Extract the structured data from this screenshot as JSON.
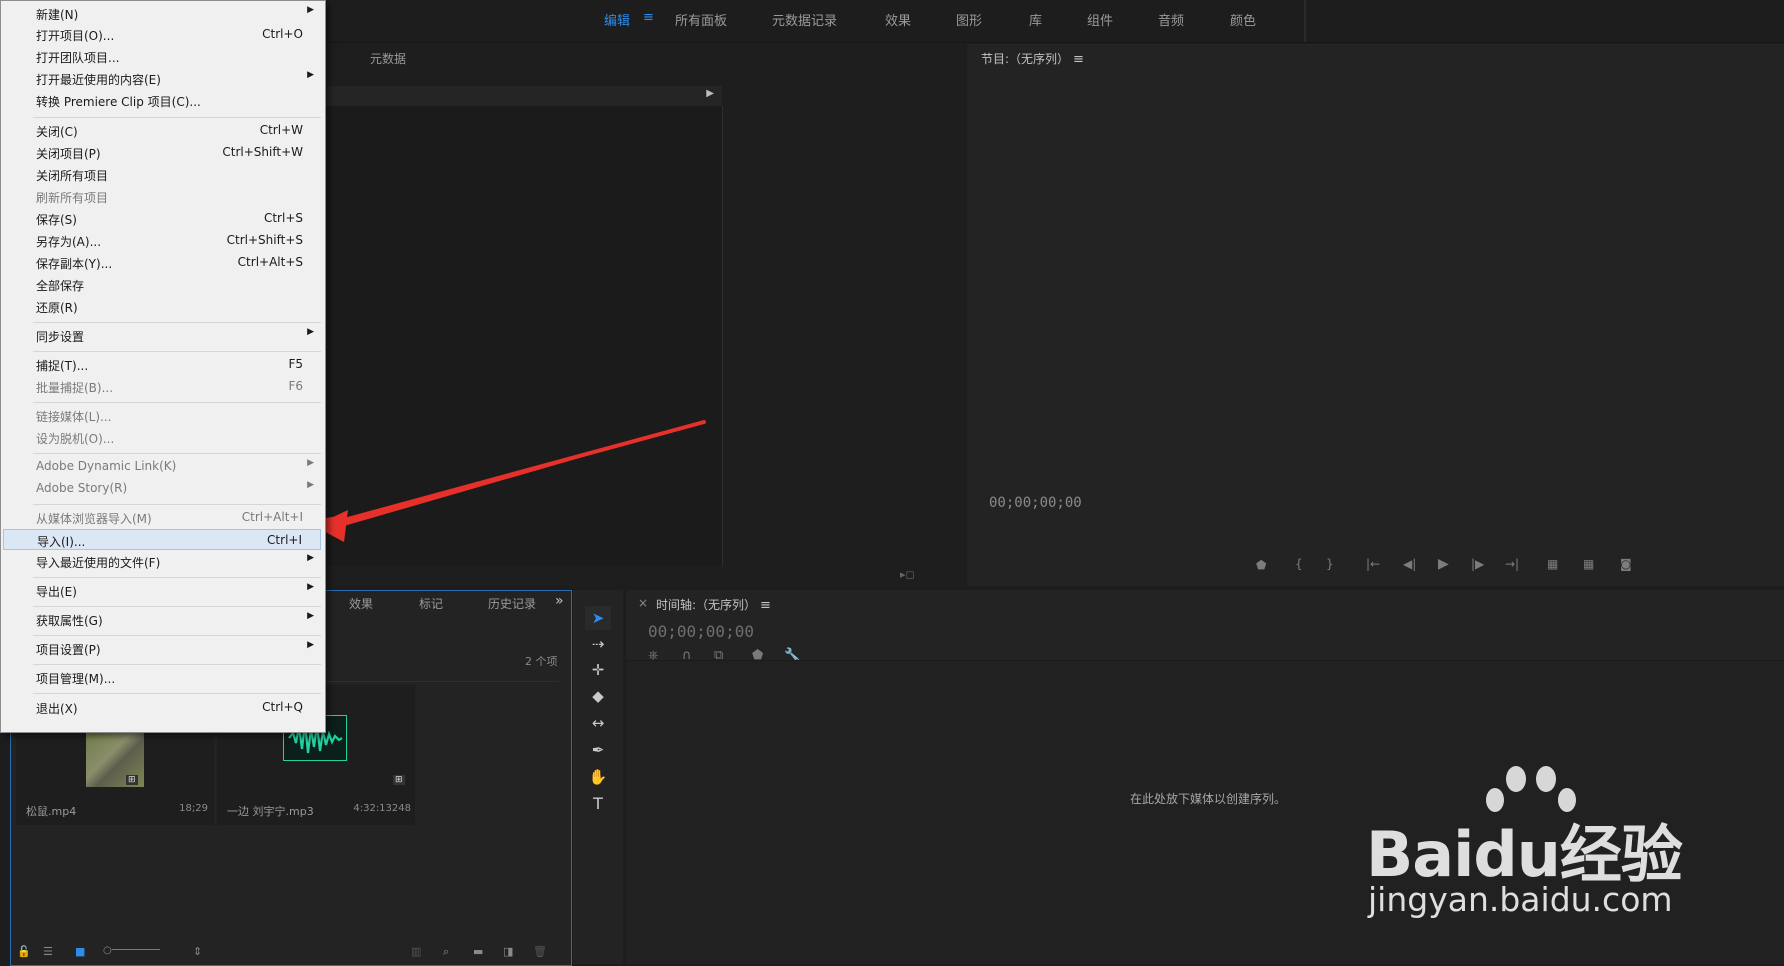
{
  "workspace": {
    "tabs": [
      {
        "label": "编辑",
        "active": true
      },
      {
        "label": "所有面板"
      },
      {
        "label": "元数据记录"
      },
      {
        "label": "效果"
      },
      {
        "label": "图形"
      },
      {
        "label": "库"
      },
      {
        "label": "组件"
      },
      {
        "label": "音频"
      },
      {
        "label": "颜色"
      }
    ],
    "menu_glyph": "≡"
  },
  "source_panel": {
    "tab_metadata": "元数据"
  },
  "program_monitor": {
    "title": "节目:（无序列）",
    "menu_glyph": "≡",
    "timecode": "00;00;00;00"
  },
  "project_panel": {
    "tabs": [
      "效果",
      "标记",
      "历史记录"
    ],
    "overflow": "»",
    "item_count": "2 个项",
    "items": [
      {
        "name": "松鼠.mp4",
        "duration": "18;29"
      },
      {
        "name": "一边 刘宇宁.mp3",
        "duration": "4:32:13248"
      }
    ]
  },
  "timeline": {
    "close": "×",
    "title": "时间轴:（无序列）",
    "menu_glyph": "≡",
    "timecode": "00;00;00;00",
    "empty_hint": "在此处放下媒体以创建序列。"
  },
  "file_menu": {
    "items": [
      {
        "label": "新建(N)",
        "shortcut": "",
        "submenu": true,
        "disabled": false
      },
      {
        "label": "打开项目(O)...",
        "shortcut": "Ctrl+O"
      },
      {
        "label": "打开团队项目..."
      },
      {
        "label": "打开最近使用的内容(E)",
        "submenu": true
      },
      {
        "label": "转换 Premiere Clip 项目(C)..."
      },
      {
        "label": "关闭(C)",
        "shortcut": "Ctrl+W"
      },
      {
        "label": "关闭项目(P)",
        "shortcut": "Ctrl+Shift+W"
      },
      {
        "label": "关闭所有项目"
      },
      {
        "label": "刷新所有项目",
        "disabled": true
      },
      {
        "label": "保存(S)",
        "shortcut": "Ctrl+S"
      },
      {
        "label": "另存为(A)...",
        "shortcut": "Ctrl+Shift+S"
      },
      {
        "label": "保存副本(Y)...",
        "shortcut": "Ctrl+Alt+S"
      },
      {
        "label": "全部保存"
      },
      {
        "label": "还原(R)"
      },
      {
        "label": "同步设置",
        "submenu": true
      },
      {
        "label": "捕捉(T)...",
        "shortcut": "F5"
      },
      {
        "label": "批量捕捉(B)...",
        "shortcut": "F6",
        "disabled": true
      },
      {
        "label": "链接媒体(L)...",
        "disabled": true
      },
      {
        "label": "设为脱机(O)...",
        "disabled": true
      },
      {
        "label": "Adobe Dynamic Link(K)",
        "submenu": true,
        "disabled": true
      },
      {
        "label": "Adobe Story(R)",
        "submenu": true,
        "disabled": true
      },
      {
        "label": "从媒体浏览器导入(M)",
        "shortcut": "Ctrl+Alt+I",
        "disabled": true
      },
      {
        "label": "导入(I)...",
        "shortcut": "Ctrl+I",
        "highlighted": true
      },
      {
        "label": "导入最近使用的文件(F)",
        "submenu": true
      },
      {
        "label": "导出(E)",
        "submenu": true
      },
      {
        "label": "获取属性(G)",
        "submenu": true
      },
      {
        "label": "项目设置(P)",
        "submenu": true
      },
      {
        "label": "项目管理(M)..."
      },
      {
        "label": "退出(X)",
        "shortcut": "Ctrl+Q"
      }
    ]
  },
  "watermark": {
    "brand": "Baidu经验",
    "url": "jingyan.baidu.com"
  },
  "colors": {
    "accent": "#2d8ceb",
    "annotation_arrow": "#e8302a",
    "audio_wave": "#22d3a0"
  }
}
